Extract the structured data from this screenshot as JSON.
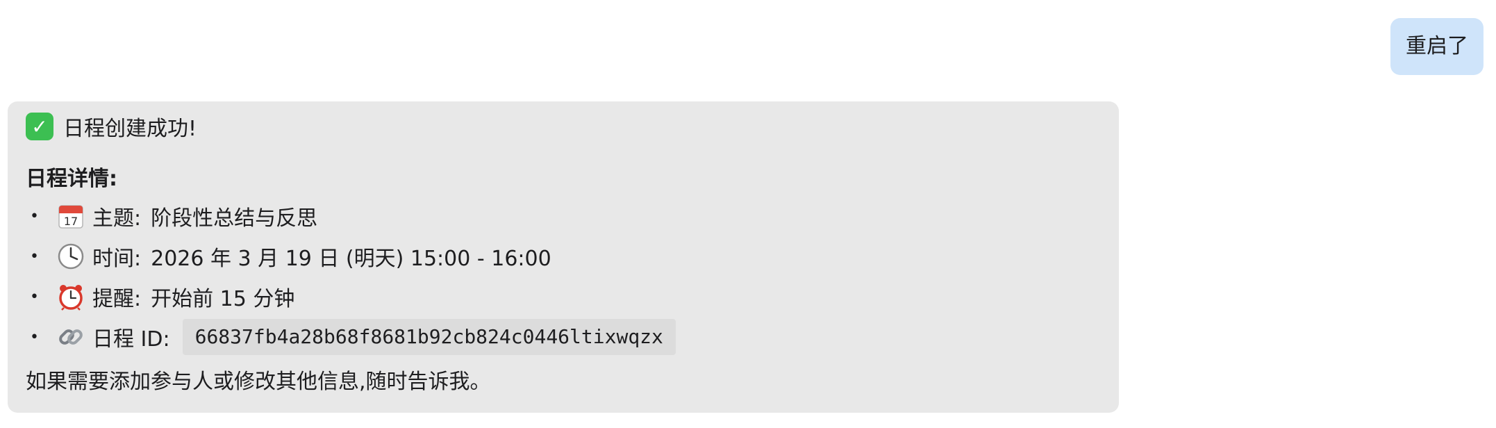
{
  "user_message": {
    "text": "重启了"
  },
  "assistant_message": {
    "success_icon": "check-mark-button-icon",
    "success_text": "日程创建成功!",
    "details_title": "日程详情:",
    "items": [
      {
        "icon": "calendar-icon",
        "label": "主题:",
        "value": "阶段性总结与反思"
      },
      {
        "icon": "clock-icon",
        "label": "时间:",
        "value": "2026 年 3 月 19 日 (明天) 15:00 - 16:00"
      },
      {
        "icon": "alarm-clock-icon",
        "label": "提醒:",
        "value": "开始前 15 分钟"
      },
      {
        "icon": "link-icon",
        "label": "日程 ID:",
        "value": "66837fb4a28b68f8681b92cb824c0446ltixwqzx"
      }
    ],
    "footer_text": "如果需要添加参与人或修改其他信息,随时告诉我。"
  },
  "colors": {
    "user_bubble": "#cfe4fa",
    "assistant_card": "#e8e8e8",
    "code_background": "#dcdcdc",
    "success_green": "#3cbf52"
  }
}
